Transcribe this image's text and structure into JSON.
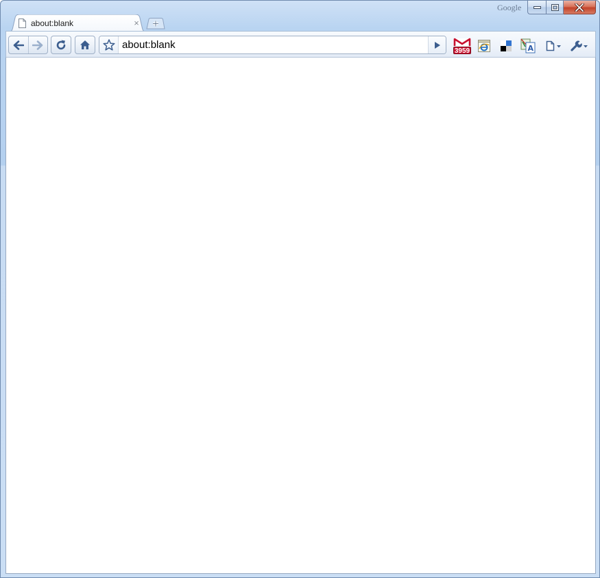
{
  "window": {
    "brand_label": "Google",
    "caption_buttons": [
      "minimize",
      "maximize",
      "close"
    ]
  },
  "tabs": [
    {
      "title": "about:blank",
      "favicon": "page-icon",
      "active": true
    }
  ],
  "tab_close_glyph": "×",
  "toolbar": {
    "back_icon": "back-arrow-icon",
    "forward_icon": "forward-arrow-icon",
    "reload_icon": "reload-icon",
    "home_icon": "home-icon"
  },
  "omnibox": {
    "url": "about:blank",
    "star_icon": "star-icon",
    "go_icon": "play-icon"
  },
  "extensions": [
    {
      "name": "gmail-checker-icon",
      "badge": "3959"
    },
    {
      "name": "ie-tab-icon"
    },
    {
      "name": "delicious-icon"
    },
    {
      "name": "google-translate-icon"
    }
  ],
  "menus": [
    "page-menu-icon",
    "wrench-menu-icon"
  ],
  "colors": {
    "frame": "#b9d4f1",
    "accent": "#3c5e8f",
    "close_button": "#c2432a",
    "gmail_badge": "#c8102e"
  }
}
